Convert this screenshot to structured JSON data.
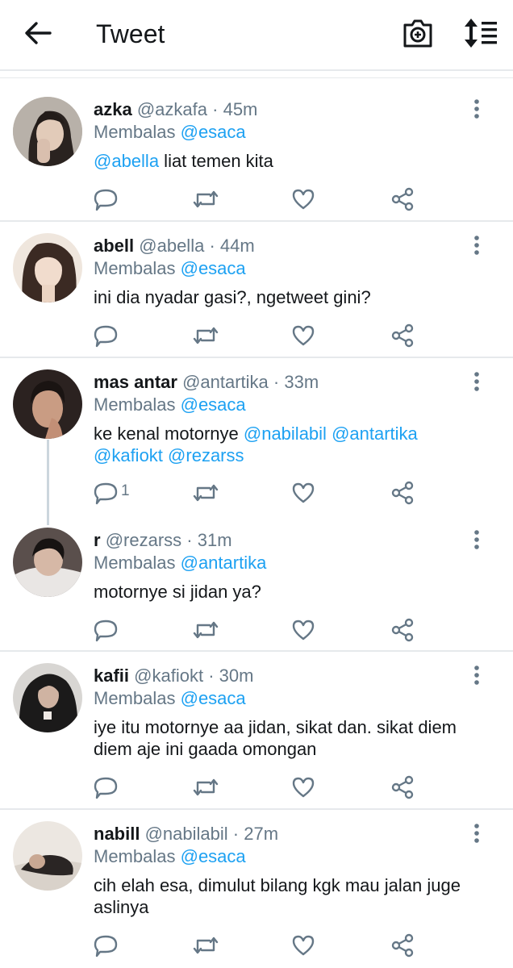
{
  "header": {
    "title": "Tweet"
  },
  "tweets": [
    {
      "name": "azka",
      "handle": "@azkafa",
      "time": "45m",
      "reply_prefix": "Membalas",
      "reply_to": "@esaca",
      "text": [
        "@abella",
        " liat temen kita"
      ],
      "replies": ""
    },
    {
      "name": "abell",
      "handle": "@abella",
      "time": "44m",
      "reply_prefix": "Membalas",
      "reply_to": "@esaca",
      "text": [
        "",
        "ini dia nyadar gasi?, ngetweet gini?"
      ],
      "replies": ""
    },
    {
      "name": "mas antar",
      "handle": "@antartika",
      "time": "33m",
      "reply_prefix": "Membalas",
      "reply_to": "@esaca",
      "text_plain": "ke kenal motornye ",
      "mentions": [
        "@nabilabil",
        "@antartika",
        "@kafiokt",
        "@rezarss"
      ],
      "replies": "1"
    },
    {
      "name": "r",
      "handle": "@rezarss",
      "time": "31m",
      "reply_prefix": "Membalas",
      "reply_to": "@antartika",
      "text": [
        "",
        "motornye si jidan ya?"
      ],
      "replies": ""
    },
    {
      "name": "kafii",
      "handle": "@kafiokt",
      "time": "30m",
      "reply_prefix": "Membalas",
      "reply_to": "@esaca",
      "text": [
        "",
        "iye itu motornye aa jidan, sikat dan. sikat diem diem aje ini gaada omongan"
      ],
      "replies": ""
    },
    {
      "name": "nabill",
      "handle": "@nabilabil",
      "time": "27m",
      "reply_prefix": "Membalas",
      "reply_to": "@esaca",
      "text": [
        "",
        "cih elah esa, dimulut bilang kgk mau jalan juge aslinya"
      ],
      "replies": ""
    }
  ],
  "dot": "·"
}
